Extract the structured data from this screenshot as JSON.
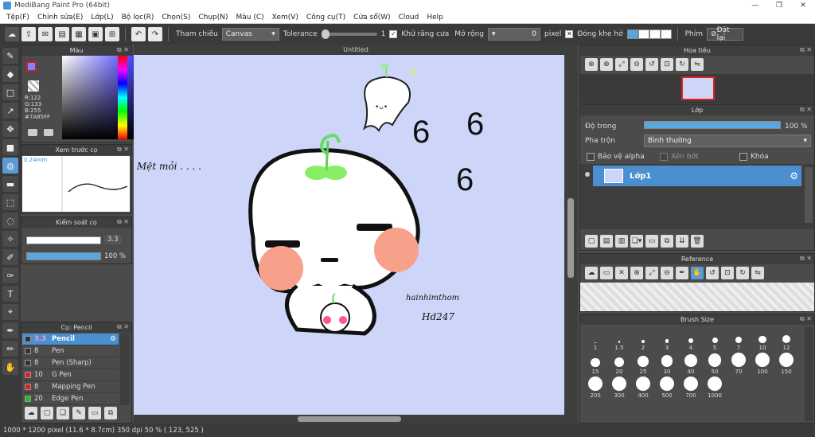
{
  "title": "MediBang Paint Pro (64bit)",
  "menu": [
    "Tệp(F)",
    "Chỉnh sửa(E)",
    "Lớp(L)",
    "Bộ lọc(R)",
    "Chọn(S)",
    "Chụp(N)",
    "Màu (C)",
    "Xem(V)",
    "Công cụ(T)",
    "Cửa sổ(W)",
    "Cloud",
    "Help"
  ],
  "toolbar": {
    "ref_label": "Tham chiếu",
    "ref_value": "Canvas",
    "tol_label": "Tolerance",
    "tol_value": "1",
    "aa_label": "Khử răng cưa",
    "expand_label": "Mở rộng",
    "expand_value": "0",
    "px": "pixel",
    "close_gap": "Đóng khe hở",
    "keys_label": "Phím",
    "reset_label": "Đặt lại"
  },
  "color_panel": {
    "title": "Màu",
    "r": "R:122",
    "g": "G:133",
    "b": "B:255",
    "hex": "#7A85FF"
  },
  "preview_panel": {
    "title": "Xem trước cọ",
    "size": "0.24mm"
  },
  "brush_control": {
    "title": "Kiểm soát cọ",
    "size": "3.3",
    "opacity": "100 %",
    "size_fill": 0.95,
    "opacity_fill": 1.0
  },
  "brush_panel": {
    "title": "Cọ: Pencil",
    "items": [
      {
        "size": "3.3",
        "name": "Pencil",
        "color": "#333333"
      },
      {
        "size": "8",
        "name": "Pen",
        "color": "#333333"
      },
      {
        "size": "8",
        "name": "Pen (Sharp)",
        "color": "#333333"
      },
      {
        "size": "10",
        "name": "G Pen",
        "color": "#e02020"
      },
      {
        "size": "8",
        "name": "Mapping Pen",
        "color": "#e02020"
      },
      {
        "size": "20",
        "name": "Edge Pen",
        "color": "#20c020"
      }
    ]
  },
  "canvas": {
    "tab": "Untitled",
    "text_left": "Mệt mỏi . . . .",
    "sig1": "hainhimthom",
    "sig2": "Hd247"
  },
  "navigator": {
    "title": "Hoa tiêu"
  },
  "layer_panel": {
    "title": "Lớp",
    "opacity_label": "Độ trong",
    "opacity_value": "100 %",
    "opacity_fill": 1.0,
    "blend_label": "Pha trộn",
    "blend_value": "Bình thường",
    "protect_alpha": "Bảo vệ alpha",
    "clipping": "Xén bớt",
    "lock": "Khóa",
    "layer_name": "Lớp1"
  },
  "reference_panel": {
    "title": "Reference"
  },
  "brush_size_panel": {
    "title": "Brush Size",
    "sizes": [
      "1",
      "1.5",
      "2",
      "3",
      "4",
      "5",
      "7",
      "10",
      "12",
      "15",
      "20",
      "25",
      "30",
      "40",
      "50",
      "70",
      "100",
      "150",
      "200",
      "300",
      "400",
      "500",
      "700",
      "1000"
    ]
  },
  "status": {
    "text": "1000 * 1200 pixel  (11.6 * 8.7cm)  350 dpi  50 %  ( 123, 525 )"
  }
}
